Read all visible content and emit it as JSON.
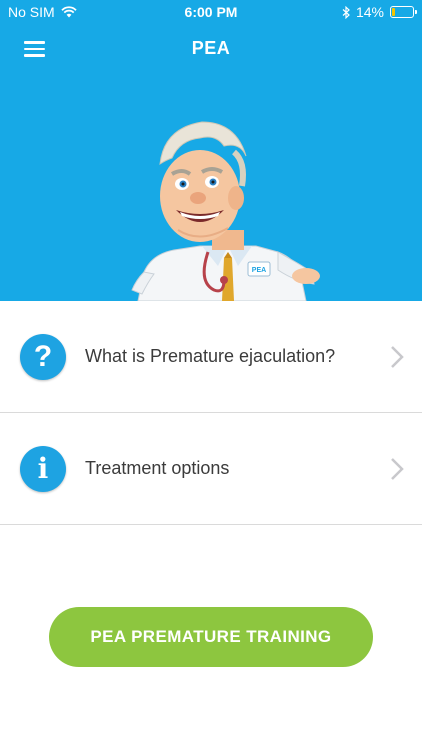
{
  "status_bar": {
    "carrier": "No SIM",
    "time": "6:00 PM",
    "battery_percent": "14%",
    "battery_level": 0.14,
    "icons": [
      "wifi-icon",
      "bluetooth-icon",
      "battery-icon"
    ]
  },
  "header": {
    "title": "PEA",
    "menu_icon": "hamburger-menu-icon",
    "background_color": "#17a9e6"
  },
  "hero": {
    "illustration": "doctor-mascot",
    "badge_text": "PEA"
  },
  "menu": {
    "items": [
      {
        "icon": "question-icon",
        "icon_glyph": "?",
        "label": "What is Premature ejaculation?"
      },
      {
        "icon": "info-icon",
        "icon_glyph": "i",
        "label": "Treatment options"
      }
    ]
  },
  "cta": {
    "label": "PEA PREMATURE TRAINING",
    "color": "#8dc63f"
  }
}
